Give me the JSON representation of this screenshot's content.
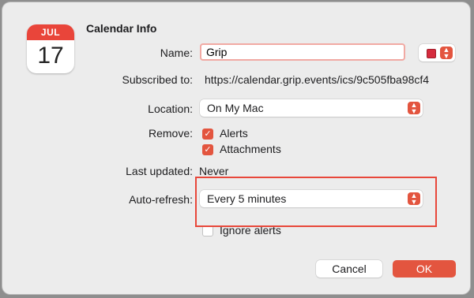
{
  "dialog": {
    "title": "Calendar Info"
  },
  "icon": {
    "month": "JUL",
    "day": "17"
  },
  "name": {
    "label": "Name:",
    "value": "Grip"
  },
  "color": {
    "swatch": "#d52b3d"
  },
  "subscribed": {
    "label": "Subscribed to:",
    "value": "https://calendar.grip.events/ics/9c505fba98cf4"
  },
  "location": {
    "label": "Location:",
    "value": "On My Mac"
  },
  "remove": {
    "label": "Remove:",
    "alerts": {
      "label": "Alerts",
      "checked": true
    },
    "attachments": {
      "label": "Attachments",
      "checked": true
    }
  },
  "last_updated": {
    "label": "Last updated:",
    "value": "Never"
  },
  "auto_refresh": {
    "label": "Auto-refresh:",
    "value": "Every 5 minutes"
  },
  "ignore_alerts": {
    "label": "Ignore alerts",
    "checked": false
  },
  "buttons": {
    "cancel": "Cancel",
    "ok": "OK"
  },
  "accent": "#e3553f"
}
